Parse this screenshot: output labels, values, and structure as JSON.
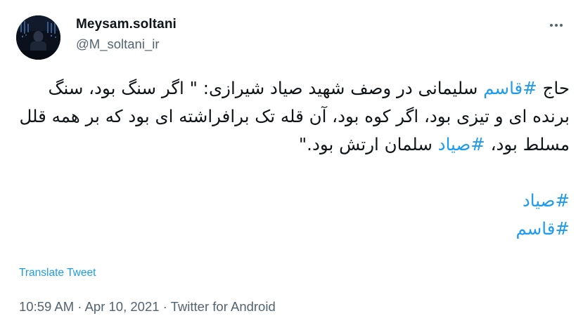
{
  "author": {
    "display_name": "Meysam.soltani",
    "handle": "@M_soltani_ir"
  },
  "tweet": {
    "line1_prefix": "حاج ",
    "hashtag_qasem": "#قاسم",
    "line1_rest": " سلیمانی در وصف شهید صیاد شیرازی: \" اگر سنگ بود، سنگ برنده ای و تیزی بود، اگر کوه بود، آن قله تک برافراشته ای بود که بر همه قلل مسلط بود، ",
    "hashtag_sayad": "#صیاد",
    "line_end": " سلمان ارتش بود.\"",
    "tag1": "#صیاد",
    "tag2": "#قاسم"
  },
  "translate_label": "Translate Tweet",
  "meta": {
    "time": "10:59 AM",
    "separator": " · ",
    "date": "Apr 10, 2021",
    "source": "Twitter for Android"
  },
  "colors": {
    "link": "#1d9bf0",
    "text": "#0f1419",
    "muted": "#536471"
  },
  "icons": {
    "more": "more-horizontal-icon"
  }
}
